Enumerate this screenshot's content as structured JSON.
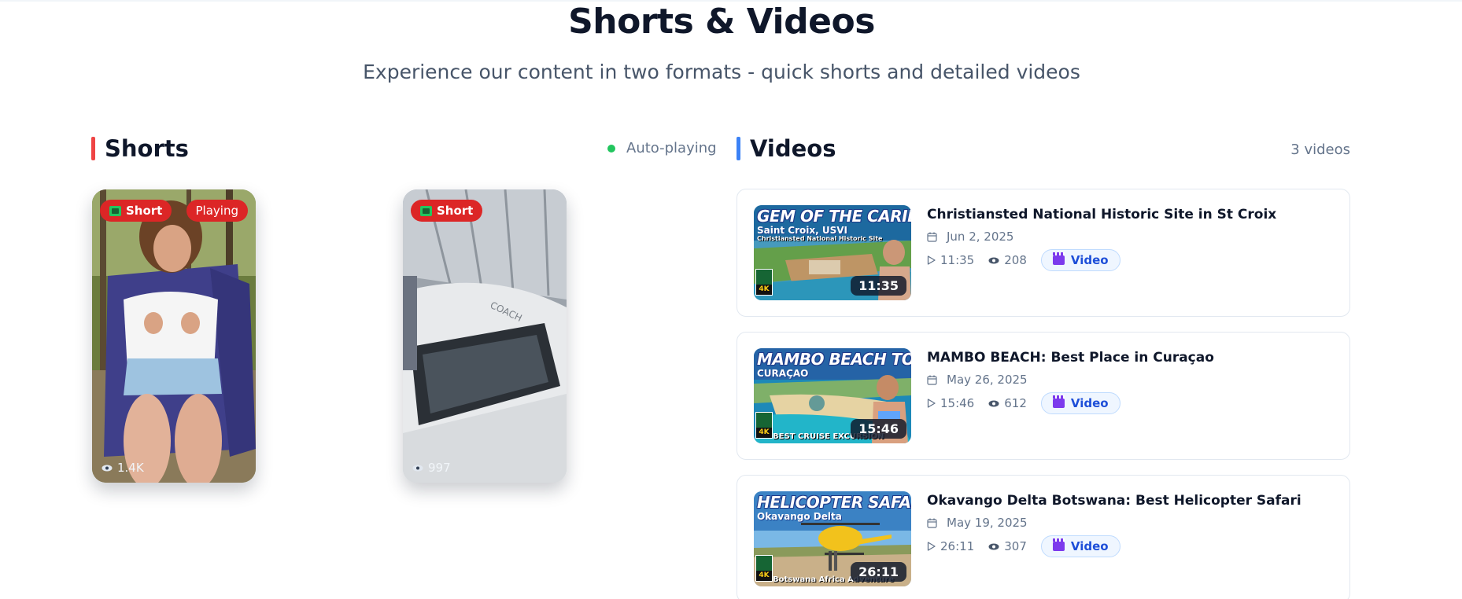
{
  "header": {
    "title": "Shorts & Videos",
    "subtitle": "Experience our content in two formats - quick shorts and detailed videos"
  },
  "shorts": {
    "heading": "Shorts",
    "status": "Auto-playing",
    "accent_color": "#ef4444",
    "items": [
      {
        "badge": "Short",
        "state_badge": "Playing",
        "views": "1.4K"
      },
      {
        "badge": "Short",
        "views": "997"
      }
    ]
  },
  "videos": {
    "heading": "Videos",
    "count_label": "3 videos",
    "accent_color": "#3b82f6",
    "items": [
      {
        "title": "Christiansted National Historic Site in St Croix",
        "date": "Jun 2, 2025",
        "duration": "11:35",
        "views": "208",
        "type_badge": "Video",
        "thumb_title": "GEM OF THE CARIBBEAN!",
        "thumb_sub": "Saint Croix, USVI",
        "thumb_foot": "Christiansted National Historic Site"
      },
      {
        "title": "MAMBO BEACH: Best Place in Curaçao",
        "date": "May 26, 2025",
        "duration": "15:46",
        "views": "612",
        "type_badge": "Video",
        "thumb_title": "MAMBO BEACH TOUR!",
        "thumb_sub": "CURAÇAO",
        "thumb_foot": "BEST CRUISE EXCURSION"
      },
      {
        "title": "Okavango Delta Botswana: Best Helicopter Safari",
        "date": "May 19, 2025",
        "duration": "26:11",
        "views": "307",
        "type_badge": "Video",
        "thumb_title": "HELICOPTER SAFARI!",
        "thumb_sub": "Okavango Delta",
        "thumb_foot": "Botswana Africa Adventure"
      }
    ]
  }
}
